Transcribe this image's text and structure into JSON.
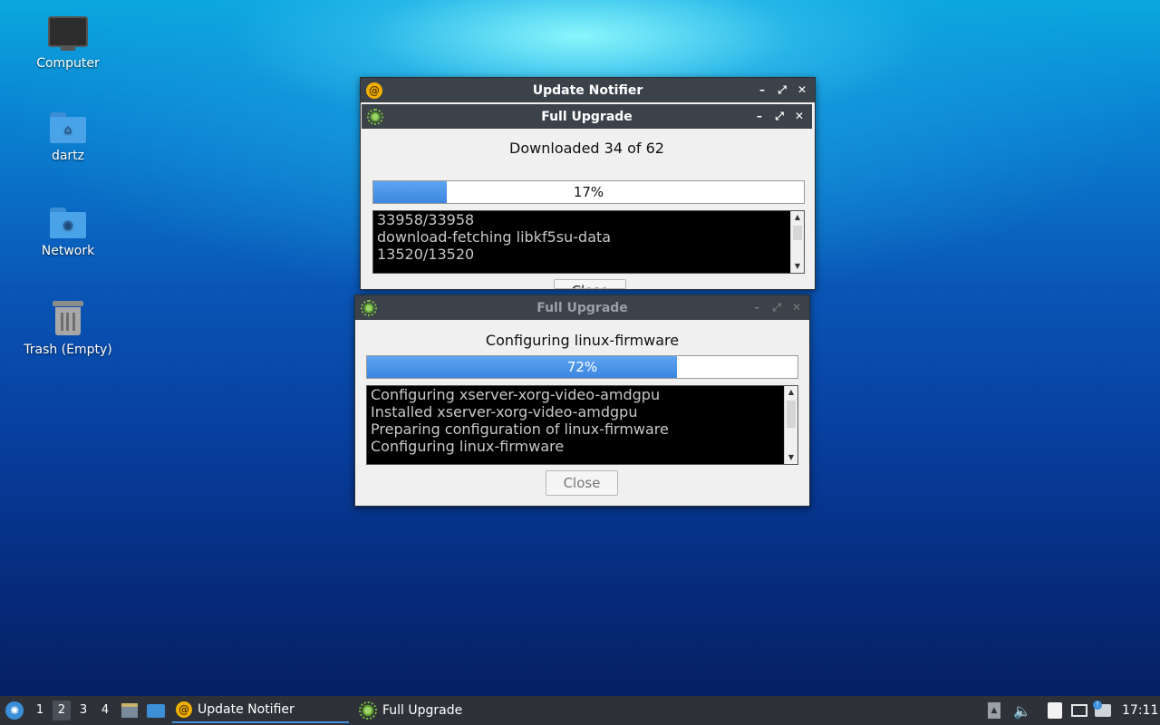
{
  "desktop": {
    "icons": [
      {
        "label": "Computer",
        "icon": "computer-icon"
      },
      {
        "label": "dartz",
        "icon": "home-folder-icon"
      },
      {
        "label": "Network",
        "icon": "network-folder-icon"
      },
      {
        "label": "Trash (Empty)",
        "icon": "trash-icon"
      }
    ]
  },
  "windows": {
    "update_notifier": {
      "title": "Update Notifier",
      "icon": "update-notifier-icon"
    },
    "upgrade1": {
      "title": "Full Upgrade",
      "status": "Downloaded 34 of 62",
      "progress": 17,
      "progress_label": "17%",
      "log": [
        "33958/33958",
        "download-fetching libkf5su-data",
        "13520/13520"
      ],
      "close_label": "Close"
    },
    "upgrade2": {
      "title": "Full Upgrade",
      "status": "Configuring linux-firmware",
      "progress": 72,
      "progress_label": "72%",
      "log": [
        "Configuring xserver-xorg-video-amdgpu",
        "Installed xserver-xorg-video-amdgpu",
        "Preparing configuration of linux-firmware",
        "Configuring linux-firmware"
      ],
      "close_label": "Close"
    },
    "controls": {
      "minimize": "–",
      "maximize": "⤢",
      "close": "✕"
    }
  },
  "taskbar": {
    "workspaces": [
      "1",
      "2",
      "3",
      "4"
    ],
    "active_workspace": "2",
    "tasks": [
      {
        "label": "Update Notifier",
        "icon": "update-notifier-icon",
        "active": true
      },
      {
        "label": "Full Upgrade",
        "icon": "gear-icon",
        "active": false
      }
    ],
    "clock": "17:11"
  },
  "colors": {
    "progress_fill": "#3d86e0",
    "titlebar": "#3c424a",
    "taskbar": "#2e3238"
  }
}
